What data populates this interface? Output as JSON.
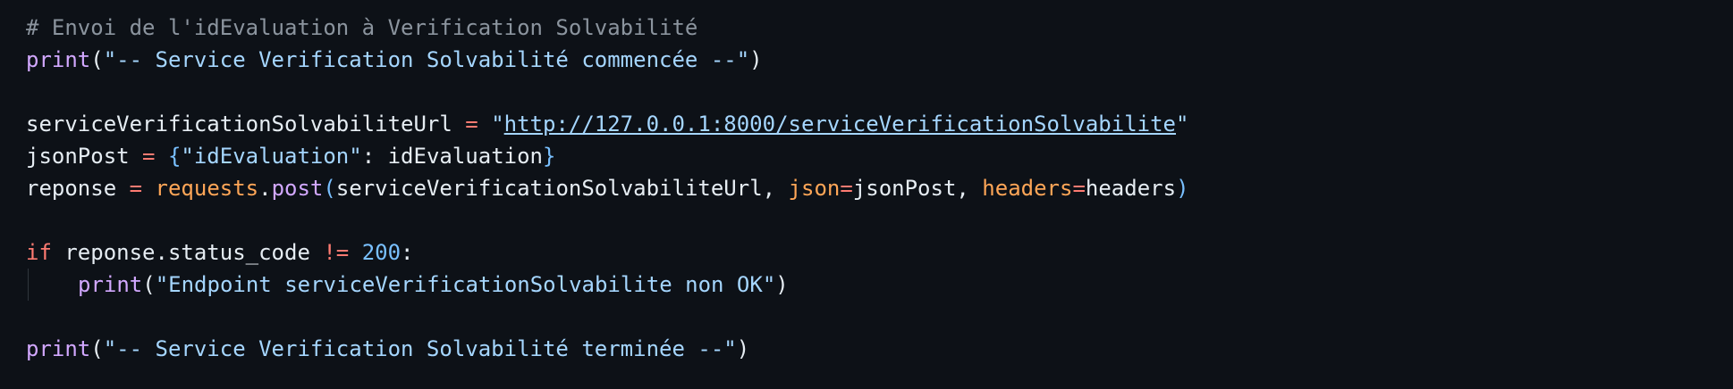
{
  "code": {
    "comment": "# Envoi de l'idEvaluation à Verification Solvabilité",
    "print1": {
      "fn": "print",
      "open": "(",
      "str": "\"-- Service Verification Solvabilité commencée --\"",
      "close": ")"
    },
    "url_line": {
      "var": "serviceVerificationSolvabiliteUrl",
      "op": " = ",
      "q1": "\"",
      "url": "http://127.0.0.1:8000/serviceVerificationSolvabilite",
      "q2": "\""
    },
    "json_line": {
      "var": "jsonPost",
      "op": " = ",
      "open": "{",
      "key": "\"idEvaluation\"",
      "colon": ": ",
      "value": "idEvaluation",
      "close": "}"
    },
    "post_line": {
      "var": "reponse",
      "op": " = ",
      "module": "requests",
      "dot": ".",
      "fn": "post",
      "open": "(",
      "arg1": "serviceVerificationSolvabiliteUrl, ",
      "kw1": "json",
      "eq1": "=",
      "val1": "jsonPost, ",
      "kw2": "headers",
      "eq2": "=",
      "val2": "headers",
      "close": ")"
    },
    "if_line": {
      "kw": "if",
      "expr": " reponse.status_code ",
      "op": "!=",
      "num": " 200",
      "colon": ":"
    },
    "print2": {
      "fn": "print",
      "open": "(",
      "str": "\"Endpoint serviceVerificationSolvabilite non OK\"",
      "close": ")"
    },
    "print3": {
      "fn": "print",
      "open": "(",
      "str": "\"-- Service Verification Solvabilité terminée --\"",
      "close": ")"
    }
  }
}
